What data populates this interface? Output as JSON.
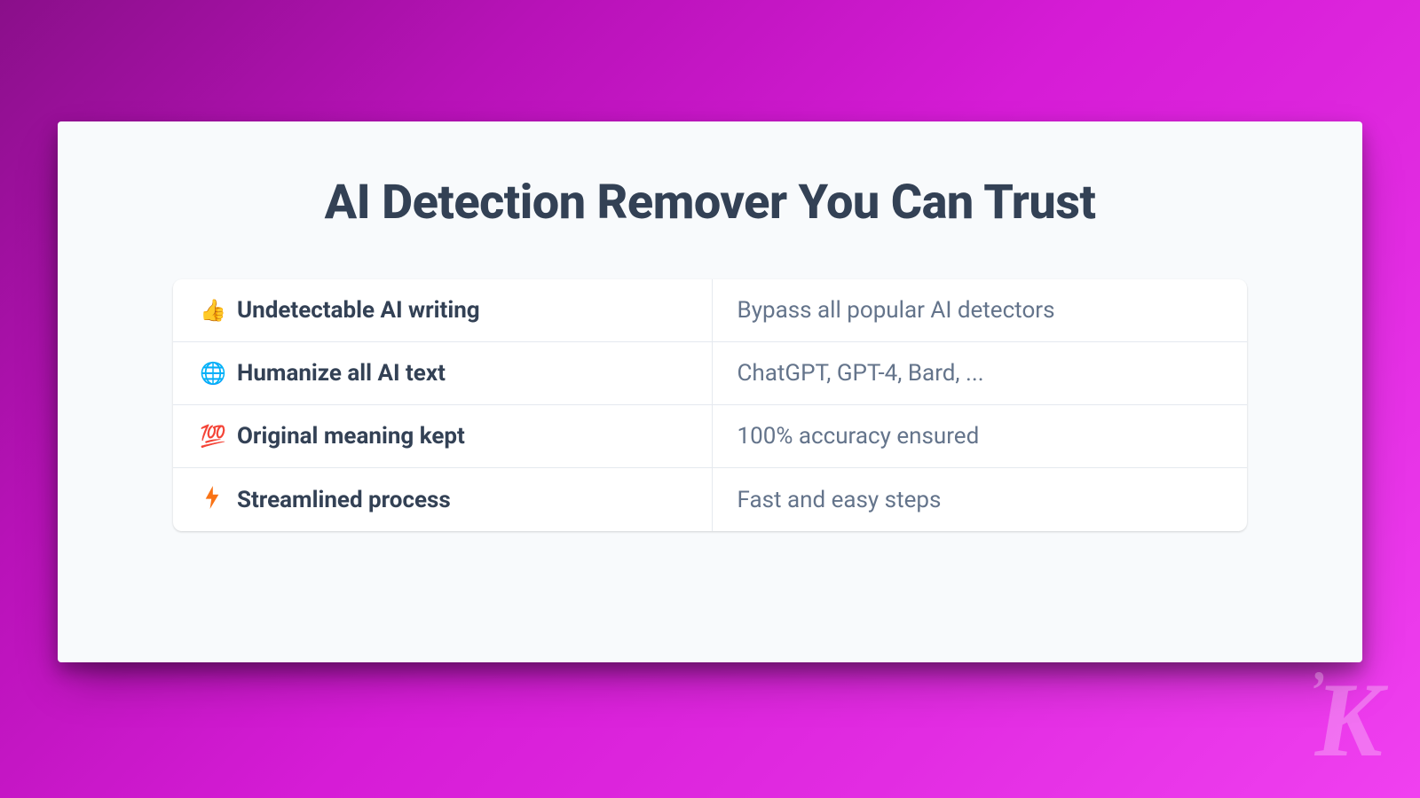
{
  "title": "AI Detection Remover You Can Trust",
  "features": [
    {
      "icon": "👍",
      "label": "Undetectable AI writing",
      "desc": "Bypass all popular AI detectors"
    },
    {
      "icon": "🌐",
      "label": "Humanize all AI text",
      "desc": "ChatGPT, GPT-4, Bard, ..."
    },
    {
      "icon": "💯",
      "label": "Original meaning kept",
      "desc": "100% accuracy ensured"
    },
    {
      "icon": "⚡",
      "label": "Streamlined process",
      "desc": "Fast and easy steps"
    }
  ],
  "watermark": "K"
}
